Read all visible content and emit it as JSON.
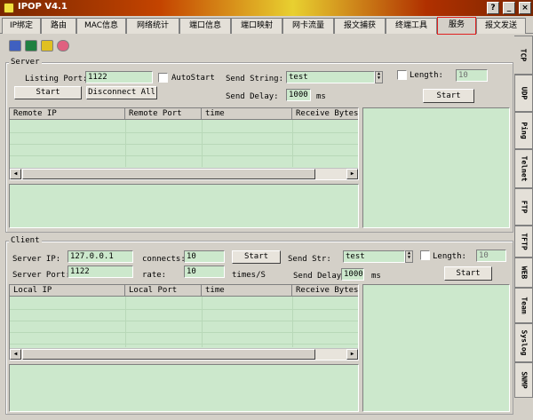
{
  "window": {
    "title": "IPOP V4.1",
    "help_glyph": "?",
    "min_glyph": "_",
    "close_glyph": "×"
  },
  "tabs": [
    {
      "label": "IP绑定"
    },
    {
      "label": "路由"
    },
    {
      "label": "MAC信息"
    },
    {
      "label": "网络统计"
    },
    {
      "label": "端口信息"
    },
    {
      "label": "端口映射"
    },
    {
      "label": "网卡流量"
    },
    {
      "label": "报文捕获"
    },
    {
      "label": "终端工具"
    },
    {
      "label": "服务"
    },
    {
      "label": "报文发送"
    }
  ],
  "side_tabs": [
    {
      "label": "TCP"
    },
    {
      "label": "UDP"
    },
    {
      "label": "Ping"
    },
    {
      "label": "Telnet"
    },
    {
      "label": "FTP"
    },
    {
      "label": "TFTP"
    },
    {
      "label": "WEB"
    },
    {
      "label": "Team"
    },
    {
      "label": "Syslog"
    },
    {
      "label": "SNMP"
    }
  ],
  "toolbar": [
    {
      "icon": "save-icon"
    },
    {
      "icon": "network-icon"
    },
    {
      "icon": "shield-icon"
    },
    {
      "icon": "heart-icon"
    }
  ],
  "server": {
    "group_label": "Server",
    "listing_port_label": "Listing Port:",
    "listing_port": "1122",
    "autostart_label": "AutoStart",
    "send_string_label": "Send String:",
    "send_string": "test",
    "send_delay_label": "Send Delay:",
    "send_delay": "1000",
    "send_delay_unit": "ms",
    "length_label": "Length:",
    "length": "10",
    "start_label": "Start",
    "disconnect_label": "Disconnect All",
    "send_start_label": "Start",
    "columns": [
      "Remote IP",
      "Remote Port",
      "time",
      "Receive Bytes"
    ]
  },
  "client": {
    "group_label": "Client",
    "server_ip_label": "Server IP:",
    "server_ip": "127.0.0.1",
    "server_port_label": "Server Port:",
    "server_port": "1122",
    "connects_label": "connects:",
    "connects": "10",
    "rate_label": "rate:",
    "rate": "10",
    "rate_unit": "times/S",
    "start_label": "Start",
    "send_str_label": "Send Str:",
    "send_str": "test",
    "send_delay_label": "Send Delay:",
    "send_delay": "1000",
    "send_delay_unit": "ms",
    "length_label": "Length:",
    "length": "10",
    "send_start_label": "Start",
    "columns": [
      "Local IP",
      "Local Port",
      "time",
      "Receive Bytes"
    ]
  },
  "colors": {
    "pane": "#cce8cc",
    "active_tab_outline": "#e02020",
    "title_bar": "#c44400"
  }
}
